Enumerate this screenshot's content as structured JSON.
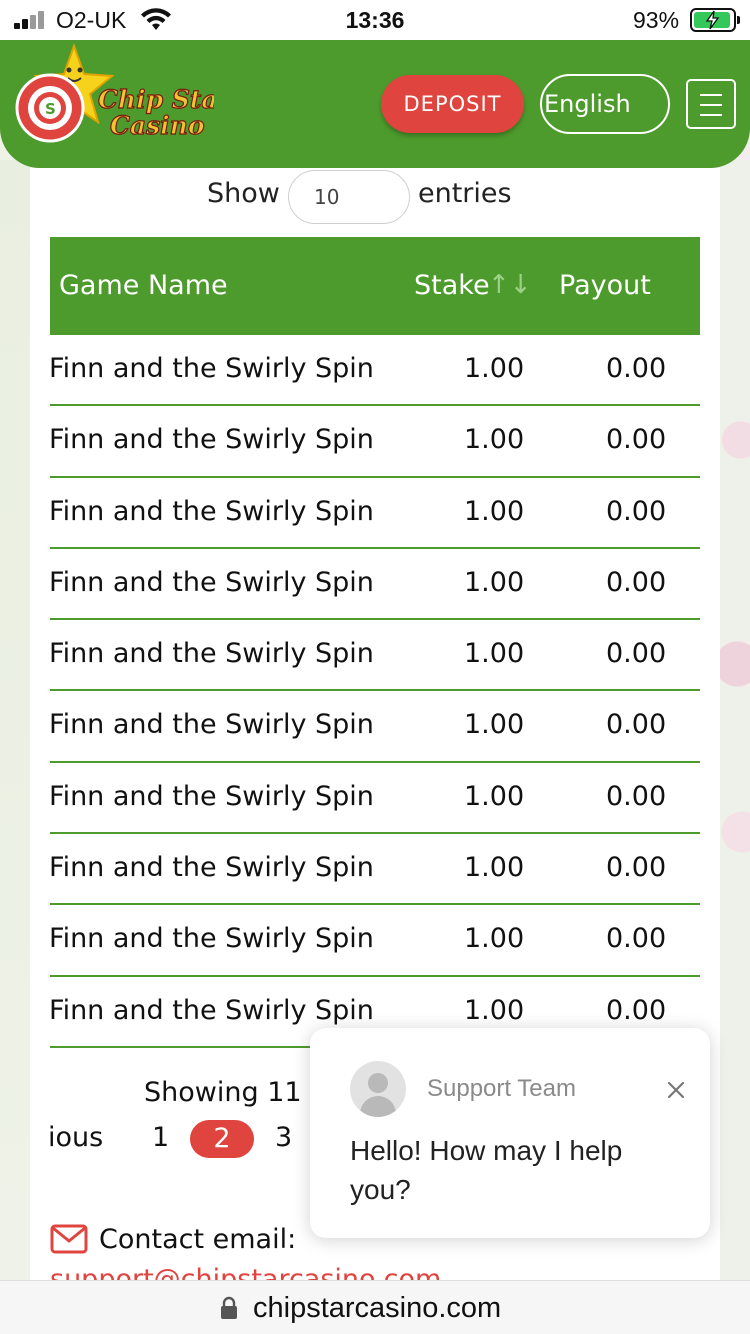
{
  "status_bar": {
    "carrier": "O2-UK",
    "time": "13:36",
    "battery_percent": "93%"
  },
  "header": {
    "logo_text_line1": "Chip Star",
    "logo_text_line2": "Casino",
    "deposit_label": "DEPOSIT",
    "language": "English"
  },
  "table_controls": {
    "show_label": "Show",
    "entries_value": "10",
    "entries_label": "entries"
  },
  "table": {
    "columns": [
      "Game Name",
      "Stake",
      "Payout"
    ],
    "sort_indicator": "↑↓",
    "rows": [
      {
        "game": "Finn and the Swirly Spin",
        "stake": "1.00",
        "payout": "0.00"
      },
      {
        "game": "Finn and the Swirly Spin",
        "stake": "1.00",
        "payout": "0.00"
      },
      {
        "game": "Finn and the Swirly Spin",
        "stake": "1.00",
        "payout": "0.00"
      },
      {
        "game": "Finn and the Swirly Spin",
        "stake": "1.00",
        "payout": "0.00"
      },
      {
        "game": "Finn and the Swirly Spin",
        "stake": "1.00",
        "payout": "0.00"
      },
      {
        "game": "Finn and the Swirly Spin",
        "stake": "1.00",
        "payout": "0.00"
      },
      {
        "game": "Finn and the Swirly Spin",
        "stake": "1.00",
        "payout": "0.00"
      },
      {
        "game": "Finn and the Swirly Spin",
        "stake": "1.00",
        "payout": "0.00"
      },
      {
        "game": "Finn and the Swirly Spin",
        "stake": "1.00",
        "payout": "0.00"
      },
      {
        "game": "Finn and the Swirly Spin",
        "stake": "1.00",
        "payout": "0.00"
      }
    ]
  },
  "pagination": {
    "info": "Showing 11",
    "previous_label": "ious",
    "pages": [
      "1",
      "2",
      "3"
    ],
    "current_page": "2"
  },
  "contact": {
    "label": "Contact email:",
    "email": "support@chipstarcasino.com"
  },
  "chat": {
    "agent_name": "Support Team",
    "message": "Hello! How may I help you?"
  },
  "browser": {
    "url": "chipstarcasino.com"
  },
  "colors": {
    "brand_green": "#4d9b2c",
    "accent_red": "#e0443e"
  }
}
